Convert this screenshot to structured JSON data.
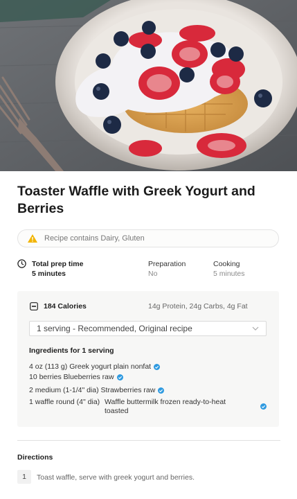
{
  "recipe": {
    "title": "Toaster Waffle with Greek Yogurt and Berries",
    "allergy_text": "Recipe contains Dairy, Gluten"
  },
  "times": {
    "total_label": "Total prep time",
    "total_value": "5 minutes",
    "prep_label": "Preparation",
    "prep_value": "No",
    "cook_label": "Cooking",
    "cook_value": "5 minutes"
  },
  "nutrition": {
    "calories": "184 Calories",
    "macros": "14g Protein, 24g Carbs, 4g Fat",
    "serving_selected": "1 serving - Recommended, Original recipe",
    "ingredients_heading": "Ingredients for 1 serving",
    "ingredients": [
      {
        "amount": "4 oz (113 g)",
        "name": "Greek yogurt plain nonfat"
      },
      {
        "amount": "10 berries",
        "name": "Blueberries raw"
      },
      {
        "amount": "2 medium (1-1/4\" dia)",
        "name": "Strawberries raw"
      },
      {
        "amount": "1 waffle round (4\" dia)",
        "name": "Waffle buttermilk frozen ready-to-heat toasted"
      }
    ]
  },
  "directions": {
    "heading": "Directions",
    "steps": [
      {
        "number": "1",
        "text": "Toast waffle, serve with greek yogurt and berries."
      }
    ]
  },
  "colors": {
    "verified_blue": "#2f9ae0",
    "warning_yellow": "#f2b400"
  }
}
